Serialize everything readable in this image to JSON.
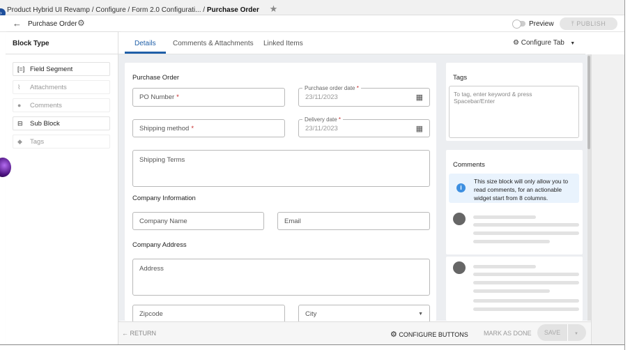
{
  "breadcrumb": {
    "items": [
      "Product Hybrid UI Revamp",
      "Configure",
      "Form 2.0 Configurati..."
    ],
    "current": "Purchase Order"
  },
  "header": {
    "title": "Purchase Order",
    "preview_label": "Preview",
    "publish_label": "PUBLISH"
  },
  "sidebar": {
    "title": "Block Type",
    "items": [
      {
        "label": "Field Segment",
        "icon": "[=]",
        "enabled": true
      },
      {
        "label": "Attachments",
        "icon": "📎",
        "enabled": false
      },
      {
        "label": "Comments",
        "icon": "●",
        "enabled": false
      },
      {
        "label": "Sub Block",
        "icon": "⊟",
        "enabled": true
      },
      {
        "label": "Tags",
        "icon": "◆",
        "enabled": false
      }
    ]
  },
  "tabs": [
    {
      "label": "Details",
      "active": true
    },
    {
      "label": "Comments & Attachments"
    },
    {
      "label": "Linked Items"
    }
  ],
  "configure_tab": "Configure Tab",
  "form": {
    "section_po": "Purchase Order",
    "po_number": "PO Number",
    "po_date_label": "Purchase order date",
    "po_date_value": "23/11/2023",
    "shipping_method": "Shipping method",
    "delivery_label": "Delivery date",
    "delivery_value": "23/11/2023",
    "shipping_terms": "Shipping Terms",
    "section_company": "Company Information",
    "company_name": "Company Name",
    "email": "Email",
    "section_address": "Company Address",
    "address": "Address",
    "zipcode": "Zipcode",
    "city": "City",
    "required_mark": "*"
  },
  "tags": {
    "title": "Tags",
    "placeholder": "To tag, enter keyword & press Spacebar/Enter"
  },
  "comments": {
    "title": "Comments",
    "info": "This size block will only allow you to read comments, for an actionable widget start from 8 columns."
  },
  "footer": {
    "return": "RETURN",
    "configure_buttons": "CONFIGURE BUTTONS",
    "mark_done": "MARK AS DONE",
    "save": "SAVE"
  }
}
